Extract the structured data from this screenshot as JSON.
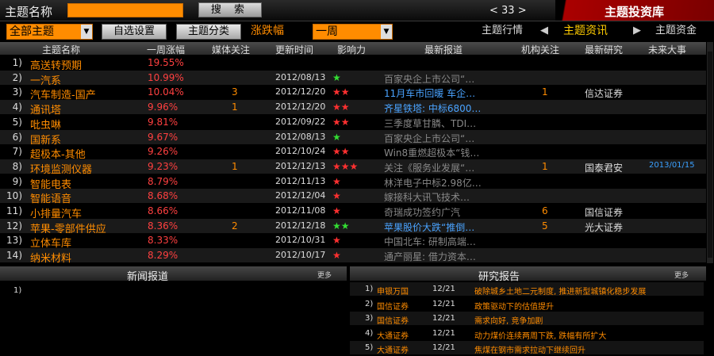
{
  "top": {
    "search_label": "主题名称",
    "search_value": "",
    "search_button": "搜 索",
    "pager": "< 33 >",
    "library": "主题投资库"
  },
  "controls": {
    "theme_select": "全部主题",
    "custom_button": "自选设置",
    "category_button": "主题分类",
    "sort_label": "涨跌幅",
    "period_select": "一周",
    "nav_left": "主题行情",
    "nav_current": "主题资讯",
    "nav_right": "主题资金"
  },
  "table": {
    "headers": [
      "主题名称",
      "一周涨幅",
      "媒体关注",
      "更新时间",
      "影响力",
      "最新报道",
      "机构关注",
      "最新研究",
      "未来大事"
    ],
    "rows": [
      {
        "idx": "1)",
        "name": "高送转预期",
        "pct": "19.55%",
        "media": "",
        "time": "",
        "stars": "",
        "sg": false,
        "news": "",
        "inst": "",
        "research": "",
        "event": ""
      },
      {
        "idx": "2)",
        "name": "一汽系",
        "pct": "10.99%",
        "media": "",
        "time": "2012/08/13",
        "stars": "★",
        "sg": true,
        "news": "百家央企上市公司“…",
        "inst": "",
        "research": "",
        "event": ""
      },
      {
        "idx": "3)",
        "name": "汽车制造-国产",
        "pct": "10.04%",
        "media": "3",
        "time": "2012/12/20",
        "stars": "★★",
        "sg": false,
        "news": "11月车市回暖 车企…",
        "inst": "1",
        "research": "信达证券",
        "event": ""
      },
      {
        "idx": "4)",
        "name": "通讯塔",
        "pct": "9.96%",
        "media": "1",
        "time": "2012/12/20",
        "stars": "★★",
        "sg": false,
        "news": "齐星铁塔: 中标6800…",
        "inst": "",
        "research": "",
        "event": ""
      },
      {
        "idx": "5)",
        "name": "吡虫啉",
        "pct": "9.81%",
        "media": "",
        "time": "2012/09/22",
        "stars": "★★",
        "sg": false,
        "news": "三季度草甘膦、TDI…",
        "inst": "",
        "research": "",
        "event": ""
      },
      {
        "idx": "6)",
        "name": "国新系",
        "pct": "9.67%",
        "media": "",
        "time": "2012/08/13",
        "stars": "★",
        "sg": true,
        "news": "百家央企上市公司“…",
        "inst": "",
        "research": "",
        "event": ""
      },
      {
        "idx": "7)",
        "name": "超极本-其他",
        "pct": "9.26%",
        "media": "",
        "time": "2012/10/24",
        "stars": "★★",
        "sg": false,
        "news": "Win8重燃超极本“钱…",
        "inst": "",
        "research": "",
        "event": ""
      },
      {
        "idx": "8)",
        "name": "环境监测仪器",
        "pct": "9.23%",
        "media": "1",
        "time": "2012/12/13",
        "stars": "★★★",
        "sg": false,
        "news": "关注《服务业发展“…",
        "inst": "1",
        "research": "国泰君安",
        "event": "2013/01/15"
      },
      {
        "idx": "9)",
        "name": "智能电表",
        "pct": "8.79%",
        "media": "",
        "time": "2012/11/13",
        "stars": "★",
        "sg": false,
        "news": "林洋电子中标2.98亿…",
        "inst": "",
        "research": "",
        "event": ""
      },
      {
        "idx": "10)",
        "name": "智能语音",
        "pct": "8.68%",
        "media": "",
        "time": "2012/12/04",
        "stars": "★",
        "sg": false,
        "news": "嫁接科大讯飞技术…",
        "inst": "",
        "research": "",
        "event": ""
      },
      {
        "idx": "11)",
        "name": "小排量汽车",
        "pct": "8.66%",
        "media": "",
        "time": "2012/11/08",
        "stars": "★",
        "sg": false,
        "news": "奇瑞成功签约广汽",
        "inst": "6",
        "research": "国信证券",
        "event": ""
      },
      {
        "idx": "12)",
        "name": "苹果-零部件供应",
        "pct": "8.36%",
        "media": "2",
        "time": "2012/12/18",
        "stars": "★★",
        "sg": true,
        "news": "苹果股价大跌“推倒…",
        "inst": "5",
        "research": "光大证券",
        "event": ""
      },
      {
        "idx": "13)",
        "name": "立体车库",
        "pct": "8.33%",
        "media": "",
        "time": "2012/10/31",
        "stars": "★",
        "sg": false,
        "news": "中国北车: 研制高端…",
        "inst": "",
        "research": "",
        "event": ""
      },
      {
        "idx": "14)",
        "name": "纳米材料",
        "pct": "8.29%",
        "media": "",
        "time": "2012/10/17",
        "stars": "★",
        "sg": false,
        "news": "通产丽星: 借力资本…",
        "inst": "",
        "research": "",
        "event": ""
      }
    ]
  },
  "news_panel": {
    "title": "新闻报道",
    "more": "更多",
    "items": [
      {
        "idx": "1)"
      }
    ]
  },
  "research_panel": {
    "title": "研究报告",
    "more": "更多",
    "items": [
      {
        "idx": "1)",
        "org": "申银万国",
        "date": "12/21",
        "title": "破除城乡土地二元制度, 推进新型城镇化稳步发展"
      },
      {
        "idx": "2)",
        "org": "国信证券",
        "date": "12/21",
        "title": "政策驱动下的估值提升"
      },
      {
        "idx": "3)",
        "org": "国信证券",
        "date": "12/21",
        "title": "需求向好, 竞争加剧"
      },
      {
        "idx": "4)",
        "org": "大通证券",
        "date": "12/21",
        "title": "动力煤价连续两周下跌, 跌幅有所扩大"
      },
      {
        "idx": "5)",
        "org": "大通证券",
        "date": "12/21",
        "title": "焦煤在钢市需求拉动下继续回升"
      }
    ]
  },
  "colors": {
    "accent": "#ff8c00",
    "up": "#ff4040",
    "star_red": "#ff3030",
    "star_green": "#33dd33",
    "link": "#4aa3ff",
    "event": "#3aa0ff"
  }
}
